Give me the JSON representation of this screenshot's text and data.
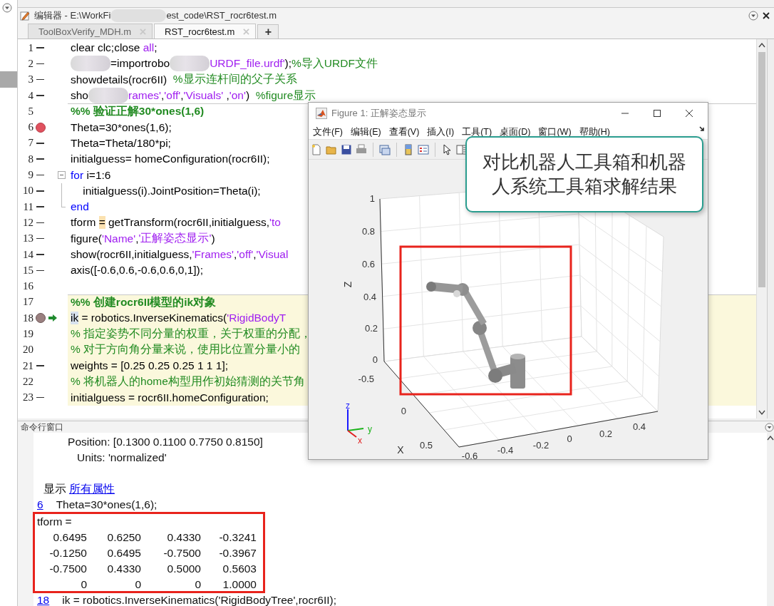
{
  "editor": {
    "title_parts": [
      {
        "kind": "text",
        "text": "编辑器 - E:\\WorkFi"
      },
      {
        "kind": "redacted"
      },
      {
        "kind": "text",
        "text": "est_code\\RST_rocr6test.m"
      }
    ],
    "tabs": [
      {
        "label": "ToolBoxVerify_MDH.m",
        "selected": false
      },
      {
        "label": "RST_rocr6test.m",
        "selected": true
      }
    ],
    "new_tab": "+",
    "lines": [
      {
        "number": "1",
        "executable": true,
        "breakpoint": false,
        "current": false,
        "cell_title": false,
        "current_cell": false,
        "segments": [
          {
            "kind": "code",
            "text": "clear clc;close "
          },
          {
            "kind": "string",
            "text": "all"
          },
          {
            "kind": "code",
            "text": ";"
          }
        ]
      },
      {
        "number": "2",
        "executable": true,
        "breakpoint": false,
        "current": false,
        "cell_title": false,
        "current_cell": false,
        "segments": [
          {
            "kind": "redacted"
          },
          {
            "kind": "code",
            "text": "=importrobo"
          },
          {
            "kind": "redacted"
          },
          {
            "kind": "string",
            "text": "URDF_file.urdf'"
          },
          {
            "kind": "code",
            "text": ");"
          },
          {
            "kind": "comment",
            "text": "%导入URDF文件"
          }
        ]
      },
      {
        "number": "3",
        "executable": true,
        "breakpoint": false,
        "current": false,
        "cell_title": false,
        "current_cell": false,
        "segments": [
          {
            "kind": "code",
            "text": "showdetails(rocr6II)  "
          },
          {
            "kind": "comment",
            "text": "%显示连杆间的父子关系"
          }
        ]
      },
      {
        "number": "4",
        "executable": true,
        "breakpoint": false,
        "current": false,
        "cell_title": false,
        "current_cell": false,
        "segments": [
          {
            "kind": "code",
            "text": "sho"
          },
          {
            "kind": "redacted"
          },
          {
            "kind": "string",
            "text": "rames'"
          },
          {
            "kind": "code",
            "text": ","
          },
          {
            "kind": "string",
            "text": "'off'"
          },
          {
            "kind": "code",
            "text": ","
          },
          {
            "kind": "string",
            "text": "'Visuals'"
          },
          {
            "kind": "code",
            "text": " ,"
          },
          {
            "kind": "string",
            "text": "'on'"
          },
          {
            "kind": "code",
            "text": ")  "
          },
          {
            "kind": "comment",
            "text": "%figure显示"
          }
        ]
      },
      {
        "number": "5",
        "executable": false,
        "breakpoint": false,
        "current": false,
        "cell_title": true,
        "current_cell": false,
        "segments": [
          {
            "kind": "cell_title",
            "text": "%% 验证正解30*ones(1,6)"
          }
        ]
      },
      {
        "number": "6",
        "breakpoint": true,
        "current": false,
        "cell_title": false,
        "current_cell": false,
        "segments": [
          {
            "kind": "code",
            "text": "Theta=30*ones(1,6);"
          }
        ]
      },
      {
        "number": "7",
        "executable": true,
        "breakpoint": false,
        "current": false,
        "cell_title": false,
        "current_cell": false,
        "segments": [
          {
            "kind": "code",
            "text": "Theta=Theta/180*pi;"
          }
        ]
      },
      {
        "number": "8",
        "executable": true,
        "breakpoint": false,
        "current": false,
        "cell_title": false,
        "current_cell": false,
        "segments": [
          {
            "kind": "code",
            "text": "initialguess= homeConfiguration(rocr6II);"
          }
        ]
      },
      {
        "number": "9",
        "executable": true,
        "breakpoint": false,
        "current": false,
        "cell_title": false,
        "current_cell": false,
        "segments": [
          {
            "kind": "keyword",
            "text": "for"
          },
          {
            "kind": "code",
            "text": " i=1:6"
          }
        ],
        "children": [
          {
            "number": "10",
            "executable": true,
            "breakpoint": false,
            "current": false,
            "cell_title": false,
            "current_cell": false,
            "segments": [
              {
                "kind": "code",
                "text": "    initialguess(i).JointPosition=Theta(i);"
              }
            ]
          },
          {
            "number": "11",
            "executable": true,
            "breakpoint": false,
            "current": false,
            "cell_title": false,
            "current_cell": false,
            "segments": [
              {
                "kind": "keyword",
                "text": "end"
              }
            ]
          }
        ]
      },
      {
        "number": "12",
        "executable": true,
        "breakpoint": false,
        "current": false,
        "cell_title": false,
        "current_cell": false,
        "segments": [
          {
            "kind": "code",
            "text": "tform "
          },
          {
            "kind": "warn",
            "text": "="
          },
          {
            "kind": "code",
            "text": " getTransform(rocr6II,initialguess,"
          },
          {
            "kind": "string",
            "text": "'to"
          }
        ]
      },
      {
        "number": "13",
        "executable": true,
        "breakpoint": false,
        "current": false,
        "cell_title": false,
        "current_cell": false,
        "segments": [
          {
            "kind": "code",
            "text": "figure("
          },
          {
            "kind": "string",
            "text": "'Name'"
          },
          {
            "kind": "code",
            "text": ","
          },
          {
            "kind": "string",
            "text": "'正解姿态显示'"
          },
          {
            "kind": "code",
            "text": ")"
          }
        ]
      },
      {
        "number": "14",
        "executable": true,
        "breakpoint": false,
        "current": false,
        "cell_title": false,
        "current_cell": false,
        "segments": [
          {
            "kind": "code",
            "text": "show(rocr6II,initialguess,"
          },
          {
            "kind": "string",
            "text": "'Frames'"
          },
          {
            "kind": "code",
            "text": ","
          },
          {
            "kind": "string",
            "text": "'off'"
          },
          {
            "kind": "code",
            "text": ","
          },
          {
            "kind": "string",
            "text": "'Visual"
          }
        ]
      },
      {
        "number": "15",
        "executable": true,
        "breakpoint": false,
        "current": false,
        "cell_title": false,
        "current_cell": false,
        "segments": [
          {
            "kind": "code",
            "text": "axis([-0.6,0.6,-0.6,0.6,0,1]);"
          }
        ]
      },
      {
        "number": "16",
        "executable": false,
        "breakpoint": false,
        "current": false
      },
      {
        "number": "17",
        "executable": false,
        "breakpoint": false,
        "current": false,
        "cell_title": true,
        "current_cell": true,
        "segments": [
          {
            "kind": "cell_title",
            "text": "%% 创建rocr6II模型的ik对象"
          }
        ]
      },
      {
        "number": "18",
        "breakpoint": true,
        "current": true,
        "cell_title": false,
        "current_cell": true,
        "segments": [
          {
            "kind": "ref",
            "text": "ik"
          },
          {
            "kind": "code",
            "text": " = robotics.InverseKinematics("
          },
          {
            "kind": "string",
            "text": "'RigidBodyT"
          }
        ]
      },
      {
        "number": "19",
        "executable": false,
        "breakpoint": false,
        "current": false,
        "cell_title": false,
        "current_cell": true,
        "segments": [
          {
            "kind": "comment",
            "text": "% 指定姿势不同分量的权重，关于权重的分配，"
          }
        ]
      },
      {
        "number": "20",
        "executable": false,
        "breakpoint": false,
        "current": false,
        "cell_title": false,
        "current_cell": true,
        "segments": [
          {
            "kind": "comment",
            "text": "% 对于方向角分量来说，使用比位置分量小的"
          }
        ]
      },
      {
        "number": "21",
        "executable": true,
        "breakpoint": false,
        "current": false,
        "cell_title": false,
        "current_cell": true,
        "segments": [
          {
            "kind": "code",
            "text": "weights = [0.25 0.25 0.25 1 1 1];"
          }
        ]
      },
      {
        "number": "22",
        "executable": false,
        "breakpoint": false,
        "current": false,
        "cell_title": false,
        "current_cell": true,
        "segments": [
          {
            "kind": "comment",
            "text": "% 将机器人的home构型用作初始猜测的关节角"
          }
        ]
      },
      {
        "number": "23",
        "executable": true,
        "breakpoint": false,
        "current": false,
        "cell_title": false,
        "current_cell": true,
        "segments": [
          {
            "kind": "code",
            "text": "initialguess = rocr6II.homeConfiguration;"
          }
        ]
      }
    ]
  },
  "command_window": {
    "title": "命令行窗口",
    "output": [
      {
        "kind": "line",
        "segments": [
          {
            "kind": "text",
            "text": "          Position: [0.1300 0.1100 0.7750 0.8150]"
          }
        ]
      },
      {
        "kind": "line",
        "segments": [
          {
            "kind": "text",
            "text": "             Units: 'normalized'"
          }
        ]
      },
      {
        "kind": "blank"
      },
      {
        "kind": "line",
        "segments": [
          {
            "kind": "text",
            "text": "  显示 "
          },
          {
            "kind": "link",
            "text": "所有属性"
          }
        ]
      },
      {
        "kind": "line",
        "segments": [
          {
            "kind": "lineref",
            "text": "6"
          },
          {
            "kind": "text",
            "text": "Theta=30*ones(1,6);"
          }
        ]
      },
      {
        "kind": "matrix",
        "boxed": true,
        "name_line": "tform =",
        "rows": [
          [
            "0.6495",
            "0.6250",
            "0.4330",
            "-0.3241"
          ],
          [
            "-0.1250",
            "0.6495",
            "-0.7500",
            "-0.3967"
          ],
          [
            "-0.7500",
            "0.4330",
            "0.5000",
            "0.5603"
          ],
          [
            "0",
            "0",
            "0",
            "1.0000"
          ]
        ]
      },
      {
        "kind": "line",
        "segments": [
          {
            "kind": "lineref",
            "text": "18"
          },
          {
            "kind": "text",
            "text": "ik = robotics.InverseKinematics('RigidBodyTree',rocr6II);"
          }
        ]
      }
    ]
  },
  "figure": {
    "title": "Figure 1: 正解姿态显示",
    "menu": [
      "文件(F)",
      "编辑(E)",
      "查看(V)",
      "插入(I)",
      "工具(T)",
      "桌面(D)",
      "窗口(W)",
      "帮助(H)"
    ],
    "axes": {
      "z_label": "Z",
      "x_label": "X",
      "z_ticks": [
        "1",
        "0.8",
        "0.6",
        "0.4",
        "0.2",
        "0"
      ],
      "x_ticks": [
        "-0.5",
        "0",
        "0.5"
      ],
      "y_ticks": [
        "-0.6",
        "-0.4",
        "-0.2",
        "0",
        "0.2",
        "0.4"
      ]
    },
    "triad": {
      "z": "z",
      "y": "y",
      "x": "x"
    },
    "annotation_box": true
  },
  "callout": {
    "text": "对比机器人工具箱和机器人系统工具箱求解结果"
  }
}
